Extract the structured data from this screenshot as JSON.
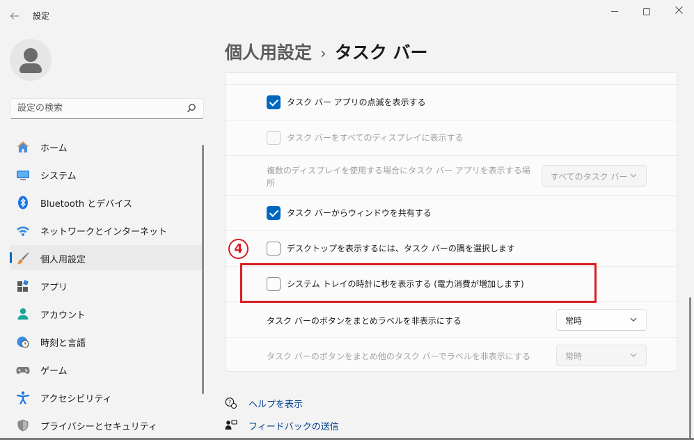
{
  "window": {
    "title": "設定",
    "back_icon": "back-arrow-icon",
    "minimize_icon": "minimize-icon",
    "maximize_icon": "maximize-icon",
    "close_icon": "close-icon"
  },
  "search": {
    "placeholder": "設定の検索",
    "icon": "search-icon"
  },
  "sidebar": {
    "selected_index": 4,
    "accent_color": "#0067c0",
    "items": [
      {
        "label": "ホーム",
        "icon": "home-icon"
      },
      {
        "label": "システム",
        "icon": "system-display-icon"
      },
      {
        "label": "Bluetooth とデバイス",
        "icon": "bluetooth-icon"
      },
      {
        "label": "ネットワークとインターネット",
        "icon": "wifi-icon"
      },
      {
        "label": "個人用設定",
        "icon": "paintbrush-icon"
      },
      {
        "label": "アプリ",
        "icon": "apps-icon"
      },
      {
        "label": "アカウント",
        "icon": "account-icon"
      },
      {
        "label": "時刻と言語",
        "icon": "clock-globe-icon"
      },
      {
        "label": "ゲーム",
        "icon": "gamepad-icon"
      },
      {
        "label": "アクセシビリティ",
        "icon": "accessibility-icon"
      },
      {
        "label": "プライバシーとセキュリティ",
        "icon": "shield-icon"
      }
    ]
  },
  "breadcrumb": {
    "parent": "個人用設定",
    "separator": "›",
    "current": "タスク バー"
  },
  "settings": {
    "rows": [
      {
        "type": "checkbox",
        "label": "タスク バー アプリの点滅を表示する",
        "checked": true,
        "disabled": false
      },
      {
        "type": "checkbox",
        "label": "タスク バーをすべてのディスプレイに表示する",
        "checked": false,
        "disabled": true
      },
      {
        "type": "dropdown",
        "label_line1": "複数のディスプレイを使用する場合にタスク バー アプリを表示する場",
        "label_line2": "所",
        "value": "すべてのタスク バー",
        "disabled": true
      },
      {
        "type": "checkbox",
        "label": "タスク バーからウィンドウを共有する",
        "checked": true,
        "disabled": false
      },
      {
        "type": "checkbox",
        "label": "デスクトップを表示するには、タスク バーの隅を選択します",
        "checked": false,
        "disabled": false
      },
      {
        "type": "checkbox",
        "label": "システム トレイの時計に秒を表示する (電力消費が増加します)",
        "checked": false,
        "disabled": false
      },
      {
        "type": "dropdown",
        "label": "タスク バーのボタンをまとめラベルを非表示にする",
        "value": "常時",
        "disabled": false
      },
      {
        "type": "dropdown",
        "label": "タスク バーのボタンをまとめ他のタスク バーでラベルを非表示にする",
        "value": "常時",
        "disabled": true
      }
    ]
  },
  "annotation": {
    "step_number": "4",
    "color": "#d81e24"
  },
  "links": {
    "help": {
      "label": "ヘルプを表示",
      "icon": "help-icon"
    },
    "feedback": {
      "label": "フィードバックの送信",
      "icon": "feedback-icon"
    }
  }
}
